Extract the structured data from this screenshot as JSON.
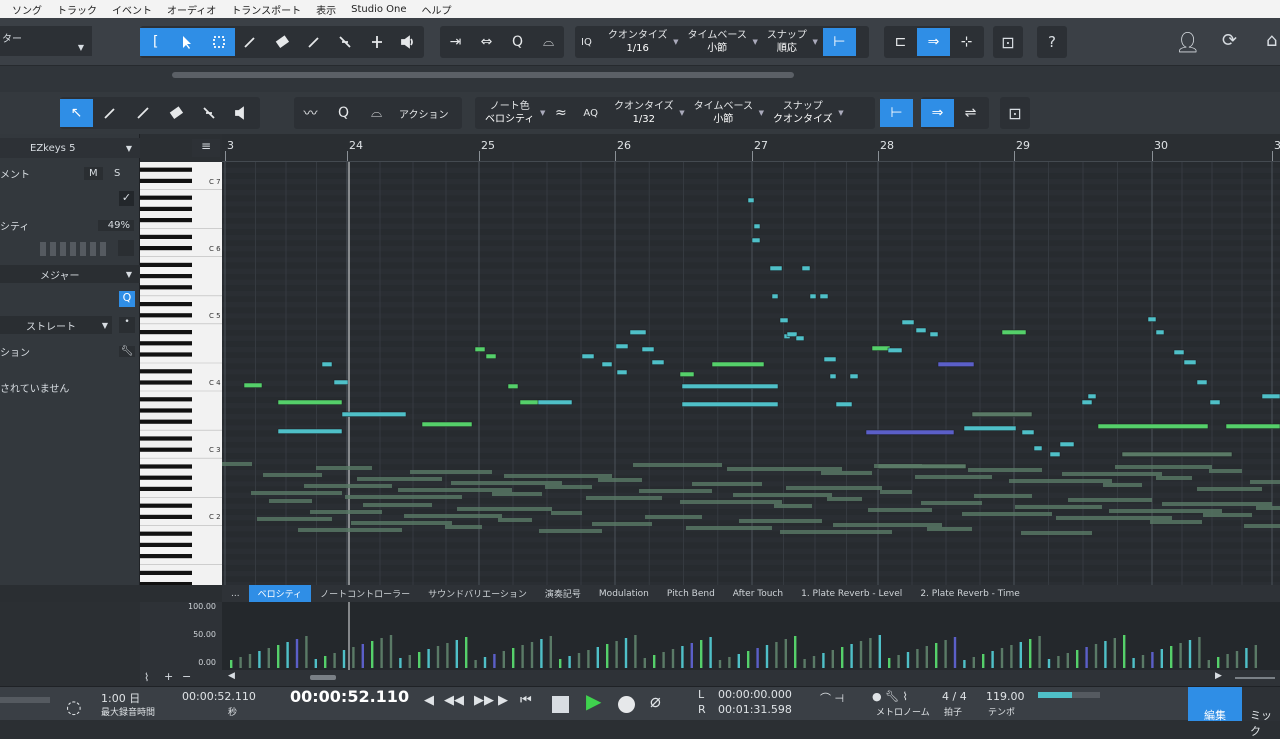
{
  "menu": [
    "ソング",
    "トラック",
    "イベント",
    "オーディオ",
    "トランスポート",
    "表示",
    "Studio One",
    "ヘルプ"
  ],
  "top": {
    "track_label": "ター",
    "quantize": {
      "label": "クオンタイズ",
      "value": "1/16"
    },
    "timebase": {
      "label": "タイムベース",
      "value": "小節"
    },
    "snap": {
      "label": "スナップ",
      "value": "順応"
    },
    "iq": "IQ",
    "help": "?"
  },
  "editor": {
    "action": "アクション",
    "notecolor": {
      "label": "ノート色",
      "value": "ベロシティ"
    },
    "aq": "AQ",
    "quantize": {
      "label": "クオンタイズ",
      "value": "1/32"
    },
    "timebase": {
      "label": "タイムベース",
      "value": "小節"
    },
    "snap": {
      "label": "スナップ",
      "value": "クオンタイズ"
    }
  },
  "inspector": {
    "instrument": "EZkeys 5",
    "ment": "メント",
    "m": "M",
    "s": "S",
    "velocity_label": "シティ",
    "velocity_value": "49%",
    "scale": "メジャー",
    "strat": "ストレート",
    "ction": "ション",
    "notset": "されていません"
  },
  "octaves": [
    "C 7",
    "C 6",
    "C 5",
    "C 4",
    "C 3",
    "C 2"
  ],
  "ruler": [
    "3",
    "24",
    "25",
    "26",
    "27",
    "28",
    "29",
    "30",
    "3"
  ],
  "lanes": [
    "...",
    "ベロシティ",
    "ノートコントローラー",
    "サウンドバリエーション",
    "演奏記号",
    "Modulation",
    "Pitch Bend",
    "After Touch",
    "1. Plate Reverb - Level",
    "2. Plate Reverb - Time"
  ],
  "vel_axis": [
    "100.00",
    "50.00",
    "0.00"
  ],
  "transport": {
    "bars": "1:00 日",
    "rec_time": "最大録音時間",
    "time_small": "00:00:52.110",
    "time_small_unit": "秒",
    "time_big": "00:00:52.110",
    "loop_l_label": "L",
    "loop_l": "00:00:00.000",
    "loop_r_label": "R",
    "loop_r": "00:01:31.598",
    "sig": "4 / 4",
    "sig_label": "拍子",
    "tempo": "119.00",
    "tempo_label": "テンポ",
    "metro_label": "メトロノーム",
    "edit_tab": "編集",
    "mix_tab": "ミック"
  },
  "colors": {
    "accent": "#2f8ee6",
    "note_green": "#55d06a",
    "note_cyan": "#4fc0c8",
    "note_blue": "#5b5fc8",
    "note_dim": "#5a7a66"
  }
}
